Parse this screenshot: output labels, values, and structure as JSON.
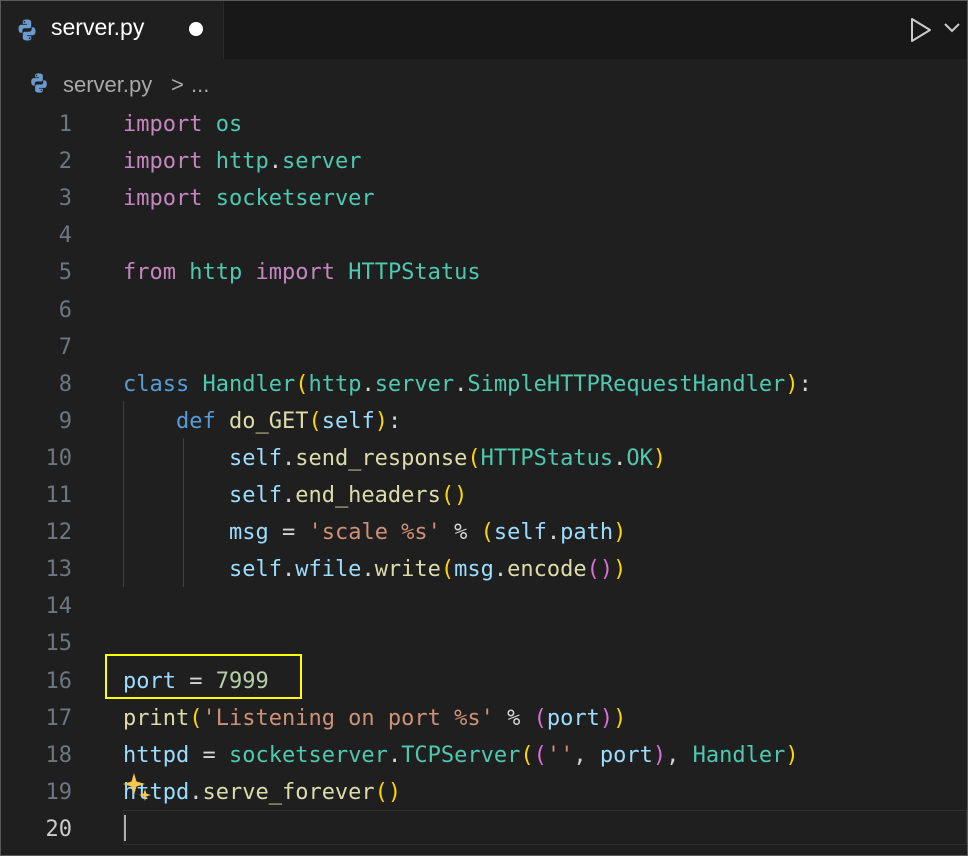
{
  "tab": {
    "filename": "server.py",
    "dirty": true
  },
  "breadcrumb": {
    "file": "server.py",
    "separator": ">",
    "more": "..."
  },
  "colors": {
    "keyword": "#c586c0",
    "storage": "#569cd6",
    "module": "#4ec9b0",
    "variable": "#9cdcfe",
    "function": "#dcdcaa",
    "string": "#ce9178",
    "number": "#b5cea8",
    "operator": "#d4d4d4",
    "bracket_gold": "#ffd700",
    "bracket_pink": "#da70d6",
    "bracket_blue": "#179fff",
    "highlight_box": "#ffff00"
  },
  "editor": {
    "active_line": "20",
    "line_numbers": [
      "1",
      "2",
      "3",
      "4",
      "5",
      "6",
      "7",
      "8",
      "9",
      "10",
      "11",
      "12",
      "13",
      "14",
      "15",
      "16",
      "17",
      "18",
      "19",
      "20"
    ],
    "lines": [
      "import os",
      "import http.server",
      "import socketserver",
      "",
      "from http import HTTPStatus",
      "",
      "",
      "class Handler(http.server.SimpleHTTPRequestHandler):",
      "    def do_GET(self):",
      "        self.send_response(HTTPStatus.OK)",
      "        self.end_headers()",
      "        msg = 'scale %s' % (self.path)",
      "        self.wfile.write(msg.encode())",
      "",
      "",
      "port = 7999",
      "print('Listening on port %s' % (port))",
      "httpd = socketserver.TCPServer(('', port), Handler)",
      "httpd.serve_forever()",
      ""
    ]
  },
  "icons": {
    "file_icon": "python-icon",
    "run": "play-icon",
    "run_menu": "chevron-down-icon",
    "inline_action": "sparkle-icon"
  }
}
